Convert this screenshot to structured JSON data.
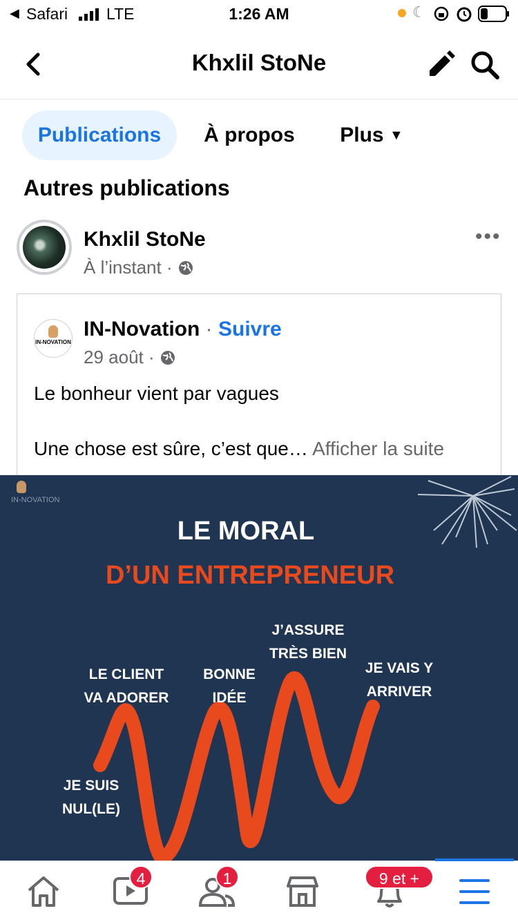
{
  "status_bar": {
    "back_app": "Safari",
    "network": "LTE",
    "time": "1:26 AM"
  },
  "header": {
    "title": "Khxlil StoNe"
  },
  "tabs": [
    {
      "label": "Publications",
      "active": true
    },
    {
      "label": "À propos"
    },
    {
      "label": "Plus"
    }
  ],
  "section_title": "Autres publications",
  "post": {
    "author": "Khxlil StoNe",
    "time": "À l’instant",
    "shared": {
      "page_name": "IN-Novation",
      "follow": "Suivre",
      "date": "29 août",
      "text_line1": "Le bonheur vient par vagues",
      "text_line2": "Une chose est sûre, c’est que…",
      "see_more": "Afficher la suite",
      "logo_text": "IN-NOVATION"
    },
    "image": {
      "title_line1": "LE MORAL",
      "title_line2": "D’UN ENTREPRENEUR",
      "label_assure_1": "J’ASSURE",
      "label_assure_2": "TRÈS BIEN",
      "label_client_1": "LE CLIENT",
      "label_client_2": "VA ADORER",
      "label_idee_1": "BONNE",
      "label_idee_2": "IDÉE",
      "label_arriver_1": "JE VAIS Y",
      "label_arriver_2": "ARRIVER",
      "label_nul_1": "JE SUIS",
      "label_nul_2": "NUL(LE)",
      "watermark": "IN-NOVATION",
      "colors": {
        "background": "#1f3552",
        "accent": "#e8491d"
      }
    }
  },
  "bottom_nav": {
    "watch_badge": "4",
    "friends_badge": "1",
    "notifications_badge": "9 et +"
  },
  "colors": {
    "brand": "#1b74e4",
    "badge": "#e41e3f"
  }
}
